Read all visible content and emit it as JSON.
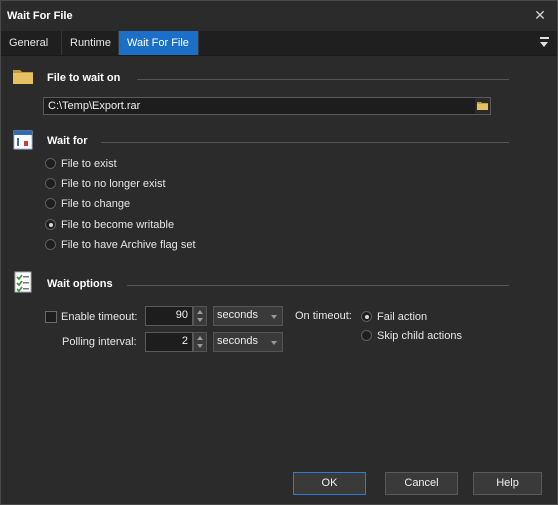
{
  "window": {
    "title": "Wait For File",
    "close_glyph": "✕"
  },
  "tabs": [
    {
      "label": "General",
      "active": false
    },
    {
      "label": "Runtime",
      "active": false
    },
    {
      "label": "Wait For File",
      "active": true
    }
  ],
  "file_section": {
    "title": "File to wait on",
    "icon": "folder-icon",
    "path_value": "C:\\Temp\\Export.rar"
  },
  "wait_for": {
    "title": "Wait for",
    "icon": "window-icon",
    "options": [
      {
        "label": "File to exist",
        "checked": false
      },
      {
        "label": "File to no longer exist",
        "checked": false
      },
      {
        "label": "File to change",
        "checked": false
      },
      {
        "label": "File to become writable",
        "checked": true
      },
      {
        "label": "File to have Archive flag set",
        "checked": false
      }
    ]
  },
  "wait_options": {
    "title": "Wait options",
    "icon": "checklist-icon",
    "enable_timeout_label": "Enable timeout:",
    "enable_timeout_checked": false,
    "timeout_value": "90",
    "timeout_unit": "seconds",
    "polling_label": "Polling interval:",
    "polling_value": "2",
    "polling_unit": "seconds",
    "on_timeout_label": "On timeout:",
    "on_timeout_options": [
      {
        "label": "Fail action",
        "checked": true
      },
      {
        "label": "Skip child actions",
        "checked": false
      }
    ]
  },
  "buttons": {
    "ok": "OK",
    "cancel": "Cancel",
    "help": "Help"
  },
  "colors": {
    "accent": "#1c6fc7",
    "background": "#2b2b2b",
    "folder": "#e7c161"
  }
}
